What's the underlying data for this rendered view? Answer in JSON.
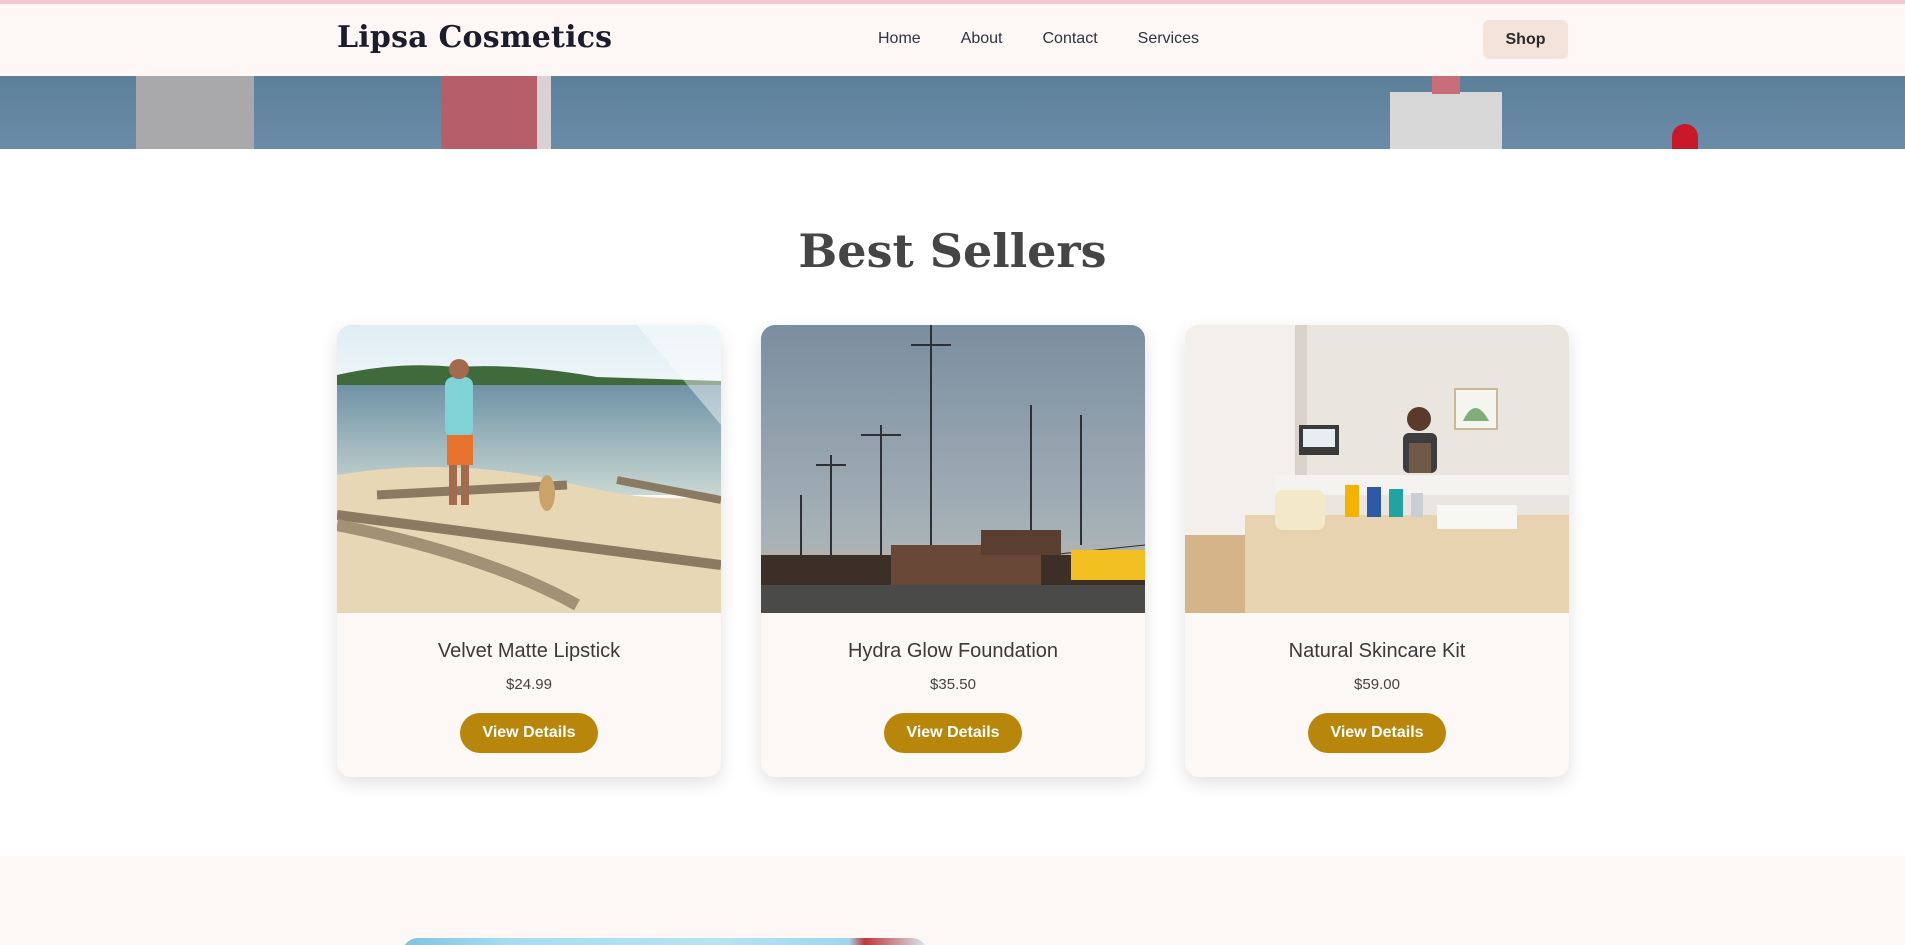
{
  "header": {
    "logo": "Lipsa Cosmetics",
    "nav": [
      "Home",
      "About",
      "Contact",
      "Services"
    ],
    "shop_label": "Shop"
  },
  "best_sellers": {
    "title": "Best Sellers",
    "products": [
      {
        "name": "Velvet Matte Lipstick",
        "price": "$24.99",
        "button": "View Details"
      },
      {
        "name": "Hydra Glow Foundation",
        "price": "$35.50",
        "button": "View Details"
      },
      {
        "name": "Natural Skincare Kit",
        "price": "$59.00",
        "button": "View Details"
      }
    ]
  },
  "colors": {
    "accent": "#b8860b",
    "header_bg": "#fdf8f5",
    "shop_button_bg": "#f4e3da",
    "hero_blue": "#5c7f9a"
  }
}
